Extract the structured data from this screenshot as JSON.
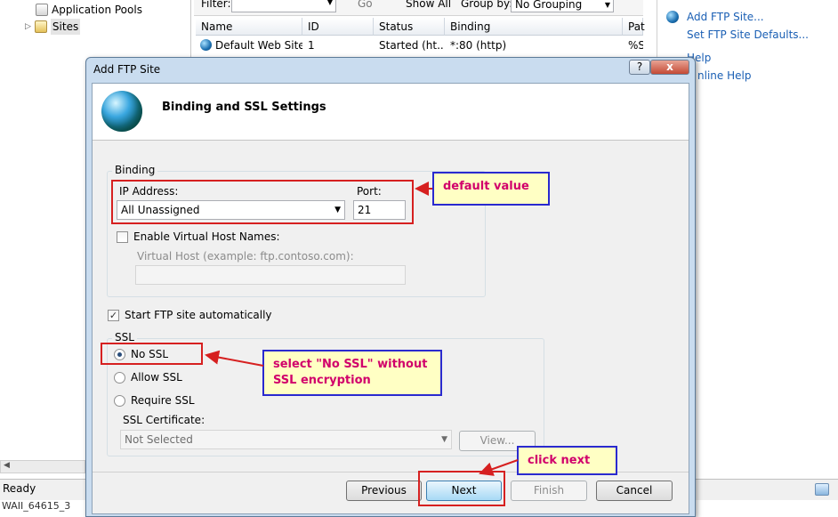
{
  "tree": {
    "items": [
      {
        "label": "Application Pools"
      },
      {
        "label": "Sites"
      }
    ]
  },
  "toolbar": {
    "filter_label": "Filter:",
    "go_label": "Go",
    "show_all_label": "Show All",
    "group_by_label": "Group by:",
    "group_by_value": "No Grouping"
  },
  "grid": {
    "columns": [
      "Name",
      "ID",
      "Status",
      "Binding",
      "Pat"
    ],
    "rows": [
      {
        "name": "Default Web Site",
        "id": "1",
        "status": "Started (ht...",
        "binding": "*:80 (http)",
        "path": "%S"
      }
    ]
  },
  "actions": {
    "add_ftp_site": "Add FTP Site...",
    "set_ftp_defaults": "Set FTP Site Defaults...",
    "help": "Help",
    "online_help": "nline Help"
  },
  "status": {
    "text": "Ready",
    "below_text": "WAII_64615_3"
  },
  "dialog": {
    "title": "Add FTP Site",
    "help_btn": "?",
    "close_btn": "x",
    "heading": "Binding and SSL Settings",
    "binding": {
      "legend": "Binding",
      "ip_label": "IP Address:",
      "ip_value": "All Unassigned",
      "port_label": "Port:",
      "port_value": "21",
      "virtual_host_check": "Enable Virtual Host Names:",
      "virtual_host_label": "Virtual Host (example: ftp.contoso.com):",
      "virtual_host_value": ""
    },
    "start_auto": "Start FTP site automatically",
    "ssl": {
      "legend": "SSL",
      "options": [
        "No SSL",
        "Allow SSL",
        "Require SSL"
      ],
      "selected": "No SSL",
      "cert_label": "SSL Certificate:",
      "cert_value": "Not Selected",
      "view_btn": "View..."
    },
    "buttons": {
      "previous": "Previous",
      "next": "Next",
      "finish": "Finish",
      "cancel": "Cancel"
    }
  },
  "callouts": {
    "default_value": "default value",
    "no_ssl": "select \"No SSL\"  without SSL encryption",
    "click_next": "click next"
  },
  "colors": {
    "callout_bg": "#ffffc4",
    "callout_text": "#d1006b",
    "callout_border": "#2a2acf",
    "highlight_red": "#d62020"
  }
}
